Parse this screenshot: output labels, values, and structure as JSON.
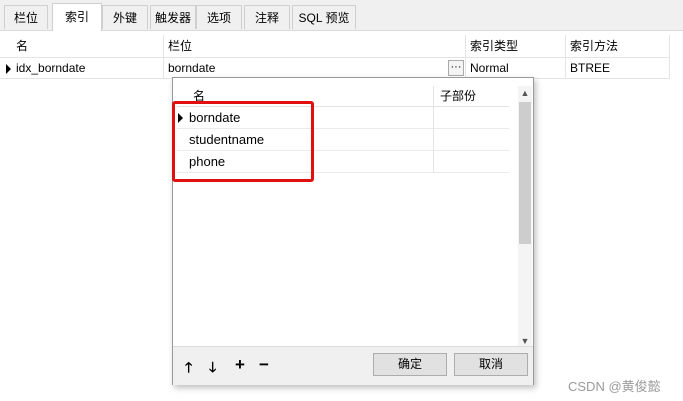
{
  "tabs": [
    "栏位",
    "索引",
    "外键",
    "触发器",
    "选项",
    "注释",
    "SQL 预览"
  ],
  "active_tab": "索引",
  "grid": {
    "columns": [
      "名",
      "栏位",
      "索引类型",
      "索引方法"
    ],
    "rows": [
      {
        "name": "idx_borndate",
        "field": "borndate",
        "ellipsis": "···",
        "type": "Normal",
        "method": "BTREE"
      }
    ]
  },
  "popup": {
    "columns": [
      "名",
      "子部份"
    ],
    "rows": [
      "borndate",
      "studentname",
      "phone"
    ],
    "arrows": {
      "up": "🡑",
      "down": "🡓",
      "add": "+",
      "remove": "−"
    },
    "ok_label": "确定",
    "cancel_label": "取消"
  },
  "highlight_color": "#e01010",
  "watermark": "CSDN @黄俊懿"
}
